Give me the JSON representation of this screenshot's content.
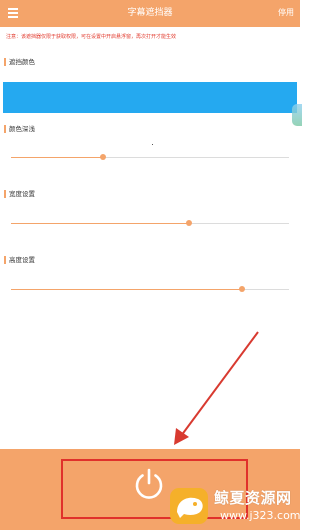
{
  "header": {
    "title": "字幕遮挡器",
    "right_label": "停用"
  },
  "notice": "注意：该遮挡器仅限于获取权限，可在设置中开启悬浮窗，再次打开才能生效",
  "sections": {
    "color": {
      "label": "遮挡颜色",
      "value": "#25a9f0"
    },
    "opacity": {
      "label": "颜色深浅",
      "value": 0.33
    },
    "width": {
      "label": "宽度设置",
      "value": 0.64
    },
    "height": {
      "label": "高度设置",
      "value": 0.83
    }
  },
  "icons": {
    "menu": "menu-icon",
    "power": "power-icon",
    "annotation_arrow": "arrow-icon"
  },
  "colors": {
    "accent": "#f4a46a",
    "notice": "#e23b2e",
    "highlight": "#e0312b"
  },
  "watermark": {
    "name": "鲸夏资源网",
    "url": "www.j323.com"
  }
}
